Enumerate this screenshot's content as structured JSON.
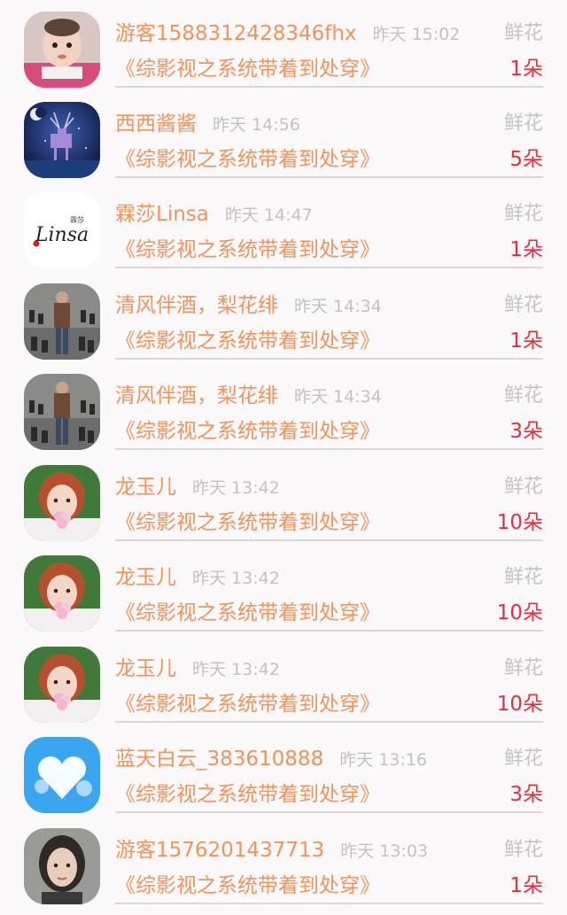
{
  "book_title": "《综影视之系统带着到处穿》",
  "gift_label": "鲜花",
  "rows": [
    {
      "username": "游客1588312428346fhx",
      "time": "昨天 15:02",
      "count": "1朵",
      "avatar": "baby-photo"
    },
    {
      "username": "西西酱酱",
      "time": "昨天 14:56",
      "count": "5朵",
      "avatar": "deer-night-art"
    },
    {
      "username": "霖莎Linsa",
      "time": "昨天 14:47",
      "count": "1朵",
      "avatar": "linsa-logo"
    },
    {
      "username": "清风伴酒，梨花绯",
      "time": "昨天 14:34",
      "count": "1朵",
      "avatar": "man-dancers-photo"
    },
    {
      "username": "清风伴酒，梨花绯",
      "time": "昨天 14:34",
      "count": "3朵",
      "avatar": "man-dancers-photo"
    },
    {
      "username": "龙玉儿",
      "time": "昨天 13:42",
      "count": "10朵",
      "avatar": "girl-flower-photo"
    },
    {
      "username": "龙玉儿",
      "time": "昨天 13:42",
      "count": "10朵",
      "avatar": "girl-flower-photo"
    },
    {
      "username": "龙玉儿",
      "time": "昨天 13:42",
      "count": "10朵",
      "avatar": "girl-flower-photo"
    },
    {
      "username": "蓝天白云_383610888",
      "time": "昨天 13:16",
      "count": "3朵",
      "avatar": "cloud-heart-icon"
    },
    {
      "username": "游客1576201437713",
      "time": "昨天 13:03",
      "count": "1朵",
      "avatar": "woman-portrait-photo"
    }
  ],
  "linsa_logo_text": "Linsa",
  "linsa_logo_cn": "霖莎"
}
